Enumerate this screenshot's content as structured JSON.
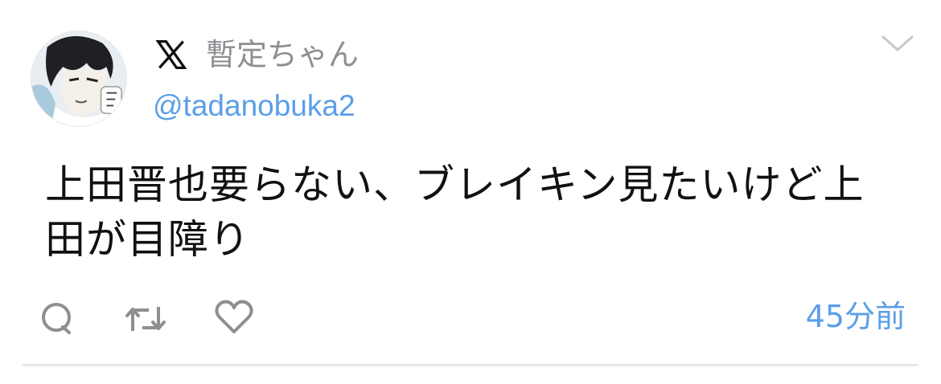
{
  "tweet": {
    "display_name": "暫定ちゃん",
    "handle": "@tadanobuka2",
    "text": "上田晋也要らない、ブレイキン見たいけど上田が目障り",
    "timestamp": "45分前"
  },
  "icons": {
    "brand": "x-logo-icon",
    "menu": "chevron-down-icon",
    "reply": "reply-icon",
    "retweet": "retweet-icon",
    "like": "heart-icon"
  },
  "colors": {
    "handle": "#5b9ee8",
    "timestamp": "#5b9ee8",
    "display_name": "#8e8e93",
    "text": "#111111",
    "icons": "#8e8e93"
  }
}
